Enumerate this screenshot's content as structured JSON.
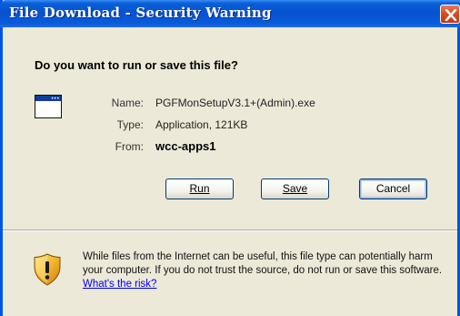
{
  "window": {
    "title": "File Download - Security Warning"
  },
  "dialog": {
    "question": "Do you want to run or save this file?",
    "fields": [
      {
        "label": "Name:",
        "value": "PGFMonSetupV3.1+(Admin).exe"
      },
      {
        "label": "Type:",
        "value": "Application, 121KB"
      },
      {
        "label": "From:",
        "value": "wcc-apps1"
      }
    ],
    "buttons": {
      "run_label": "Run",
      "save_label": "Save",
      "cancel_label": "Cancel"
    },
    "warning": {
      "text": "While files from the Internet can be useful, this file type can potentially harm your computer. If you do not trust the source, do not run or save this software. ",
      "link": "What's the risk?"
    }
  },
  "icons": {
    "app": "application-window-icon",
    "shield": "security-shield-icon",
    "close": "close-icon"
  }
}
